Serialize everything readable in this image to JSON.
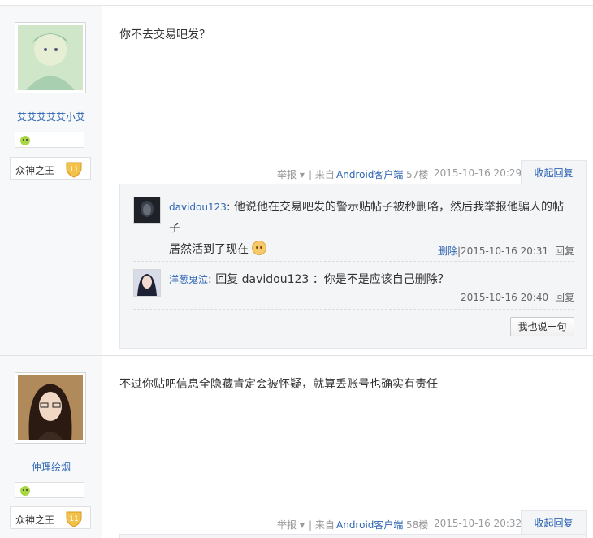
{
  "posts": [
    {
      "user": {
        "name": "艾艾艾艾艾小艾",
        "rank_title": "众神之王",
        "rank_level": "11"
      },
      "content": "你不去交易吧发？",
      "tail": {
        "report": "举报",
        "separator": "| 来自",
        "from_link": "Android客户端",
        "floor": "57楼",
        "time": "2015-10-16 20:29",
        "collapse": "收起回复"
      },
      "replies": [
        {
          "user": "davidou123",
          "colon": ":",
          "text_line1": "他说他在交易吧发的警示贴帖子被秒删咯，然后我举报他骗人的帖子",
          "text_line2": "居然活到了现在",
          "delete": "删除",
          "time": "|2015-10-16 20:31",
          "reply": "回复"
        },
        {
          "user": "洋葱鬼泣",
          "colon": ":",
          "text": "回复 davidou123 ：你是不是应该自己删除？",
          "time": "2015-10-16 20:40",
          "reply": "回复"
        }
      ],
      "say_button": "我也说一句"
    },
    {
      "user": {
        "name": "仲理绘烟",
        "rank_title": "众神之王",
        "rank_level": "11"
      },
      "content": "不过你贴吧信息全隐藏肯定会被怀疑，就算丢账号也确实有责任",
      "tail": {
        "report": "举报",
        "separator": "| 来自",
        "from_link": "Android客户端",
        "floor": "58楼",
        "time": "2015-10-16 20:32",
        "collapse": "收起回复"
      }
    }
  ],
  "colors": {
    "link": "#2d64b3",
    "sidebar_bg": "#f7f8fa",
    "reply_bg": "#f4f5f7",
    "meta": "#999999"
  }
}
